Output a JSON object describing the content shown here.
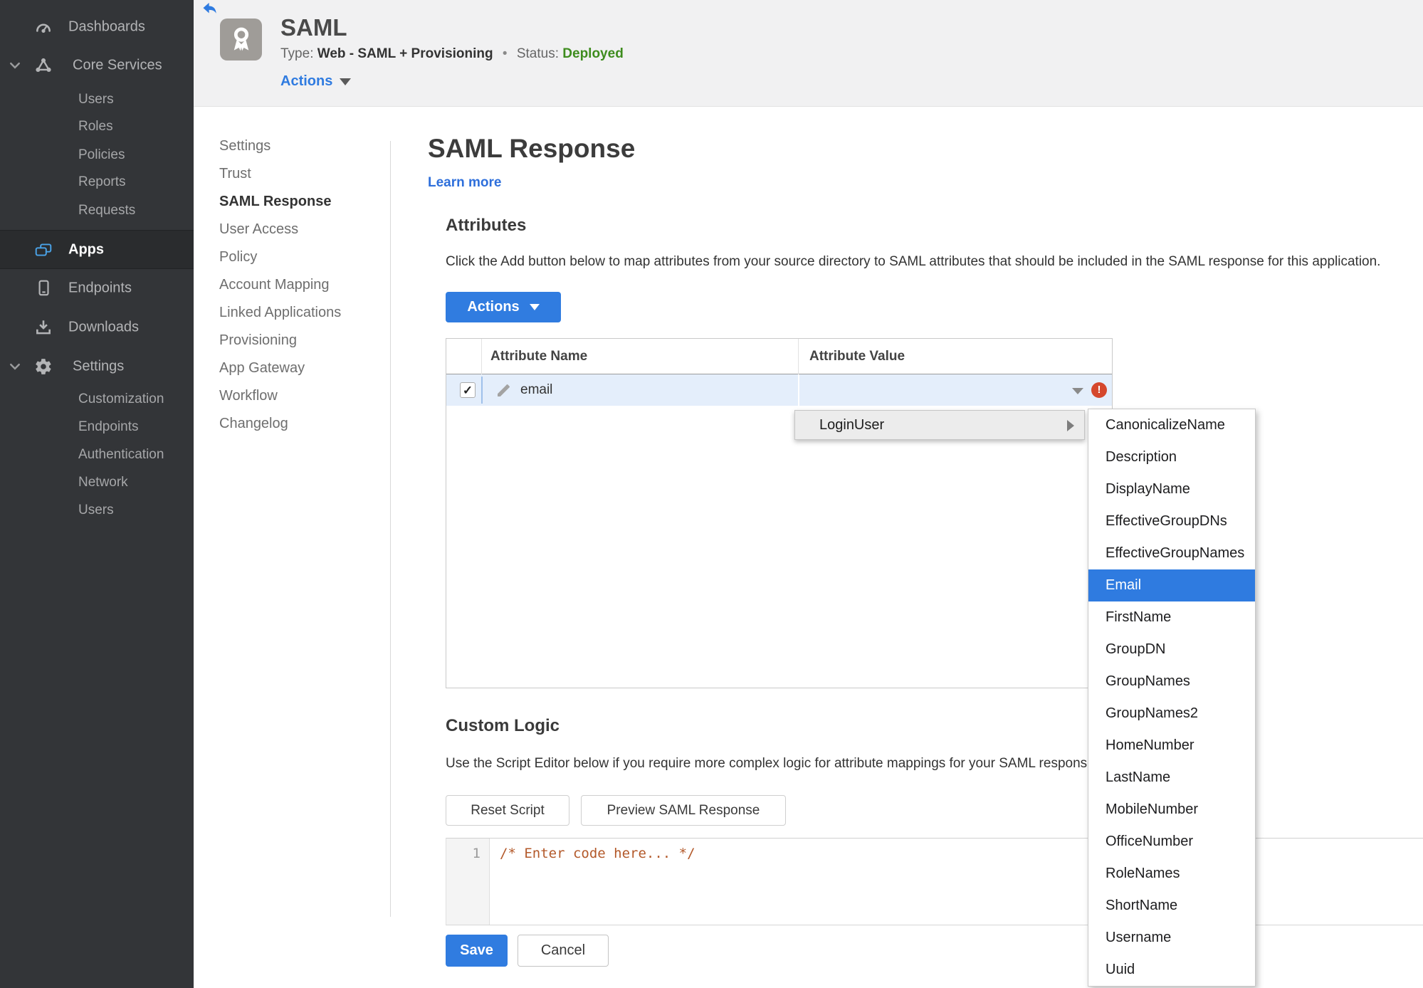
{
  "colors": {
    "accent_blue": "#307ce0",
    "link_blue": "#2e6fdb",
    "status_green": "#3e8c1e",
    "error_red": "#d5472c",
    "sidebar_bg": "#333538",
    "row_highlight": "#e4eefb",
    "menu_selected": "#2f7be0"
  },
  "sidebar": {
    "items": [
      {
        "label": "Dashboards"
      },
      {
        "label": "Core Services"
      },
      {
        "label": "Users"
      },
      {
        "label": "Roles"
      },
      {
        "label": "Policies"
      },
      {
        "label": "Reports"
      },
      {
        "label": "Requests"
      },
      {
        "label": "Apps"
      },
      {
        "label": "Endpoints"
      },
      {
        "label": "Downloads"
      },
      {
        "label": "Settings"
      },
      {
        "label": "Customization"
      },
      {
        "label": "Endpoints"
      },
      {
        "label": "Authentication"
      },
      {
        "label": "Network"
      },
      {
        "label": "Users"
      }
    ]
  },
  "header": {
    "title": "SAML",
    "type_label": "Type:",
    "type_value": "Web - SAML + Provisioning",
    "dot": "•",
    "status_label": "Status:",
    "status_value": "Deployed",
    "actions_label": "Actions"
  },
  "subnav": {
    "items": [
      "Settings",
      "Trust",
      "SAML Response",
      "User Access",
      "Policy",
      "Account Mapping",
      "Linked Applications",
      "Provisioning",
      "App Gateway",
      "Workflow",
      "Changelog"
    ],
    "active": "SAML Response"
  },
  "main": {
    "title": "SAML Response",
    "learn_more": "Learn more",
    "attributes": {
      "heading": "Attributes",
      "description": "Click the Add button below to map attributes from your source directory to SAML attributes that should be included in the SAML response for this application.",
      "actions_label": "Actions",
      "columns": [
        "Attribute Name",
        "Attribute Value"
      ],
      "row": {
        "name": "email",
        "checked": "✓",
        "error": "!"
      },
      "dropdown": {
        "label": "LoginUser",
        "selected": "Email",
        "submenu": [
          "CanonicalizeName",
          "Description",
          "DisplayName",
          "EffectiveGroupDNs",
          "EffectiveGroupNames",
          "Email",
          "FirstName",
          "GroupDN",
          "GroupNames",
          "GroupNames2",
          "HomeNumber",
          "LastName",
          "MobileNumber",
          "OfficeNumber",
          "RoleNames",
          "ShortName",
          "Username",
          "Uuid"
        ]
      }
    },
    "custom_logic": {
      "heading": "Custom Logic",
      "description": "Use the Script Editor below if you require more complex logic for attribute mappings for your SAML response.",
      "reset_label": "Reset Script",
      "preview_label": "Preview SAML Response",
      "editor": {
        "line_number": "1",
        "code": "/* Enter code here... */"
      }
    },
    "save_label": "Save",
    "cancel_label": "Cancel"
  }
}
